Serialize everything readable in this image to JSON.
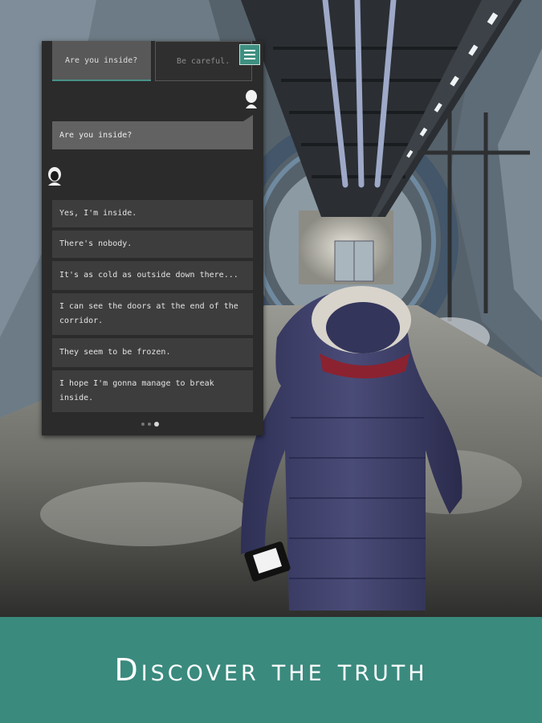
{
  "tabs": [
    {
      "label": "Are you inside?",
      "active": true
    },
    {
      "label": "Be careful.",
      "active": false
    }
  ],
  "menu_icon": "hamburger-menu-icon",
  "conversation": {
    "sent_message": "Are you inside?",
    "replies": [
      "Yes, I'm inside.",
      "There's nobody.",
      "It's as cold as outside down there...",
      "I can see the doors at the end of the corridor.",
      "They seem to be frozen.",
      "I hope I'm gonna manage to break inside."
    ]
  },
  "pager": {
    "pages": 3,
    "current": 3
  },
  "banner": {
    "title": "Discover the truth"
  },
  "colors": {
    "accent": "#3a8a7e",
    "panel": "#2b2b2b",
    "bubble": "#3d3d3d"
  }
}
